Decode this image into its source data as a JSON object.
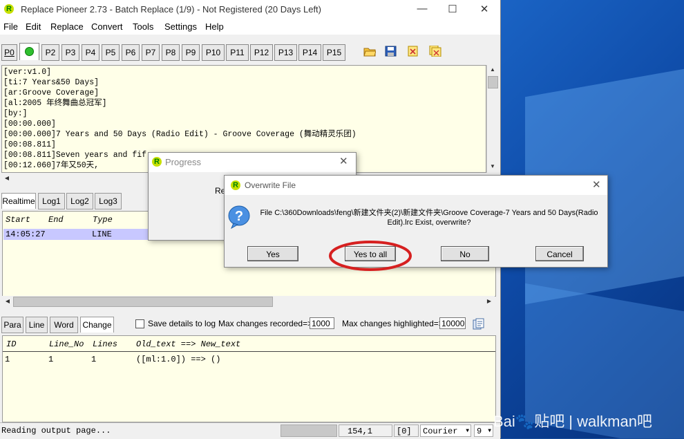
{
  "window": {
    "title": "Replace Pioneer 2.73 - Batch Replace (1/9) - Not Registered (20 Days Left)",
    "logo_letter": "R",
    "minimize": "—",
    "maximize": "☐",
    "close": "✕"
  },
  "menu": [
    "File",
    "Edit",
    "Replace",
    "Convert",
    "Tools",
    "Settings",
    "Help"
  ],
  "ptabs": [
    "P0",
    "",
    "P2",
    "P3",
    "P4",
    "P5",
    "P6",
    "P7",
    "P8",
    "P9",
    "P10",
    "P11",
    "P12",
    "P13",
    "P14",
    "P15"
  ],
  "editor_lines": [
    "[ver:v1.0]",
    "[ti:7 Years&50 Days]",
    "[ar:Groove Coverage]",
    "[al:2005 年终舞曲总冠军]",
    "[by:]",
    "[00:00.000]",
    "[00:00.000]7 Years and 50 Days (Radio Edit) - Groove Coverage (舞动精灵乐团)",
    "[00:08.811]",
    "[00:08.811]Seven years and fif",
    "[00:12.060]7年又50天,"
  ],
  "log_tabs": [
    "Realtime",
    "Log1",
    "Log2",
    "Log3"
  ],
  "log_headers": {
    "start": "Start",
    "end": "End",
    "type": "Type"
  },
  "log_row": {
    "start": "14:05:27",
    "type": "LINE"
  },
  "bottom_tabs": [
    "Para",
    "Line",
    "Word",
    "Change"
  ],
  "options": {
    "save_details": "Save details to log",
    "max_recorded_label": "Max changes recorded=>",
    "max_recorded": "1000",
    "max_highlighted_label": "Max changes highlighted=>",
    "max_highlighted": "10000"
  },
  "change_headers": {
    "id": "ID",
    "line_no": "Line_No",
    "lines": "Lines",
    "old_new": "Old_text ==> New_text"
  },
  "change_row": {
    "id": "1",
    "line_no": "1",
    "lines": "1",
    "text": "([ml:1.0]) ==> ()"
  },
  "status": {
    "message": "Reading output page...",
    "position": "154,1",
    "count": "[0]",
    "font": "Courier",
    "size": "9"
  },
  "progress_dialog": {
    "title": "Progress",
    "text": "Re"
  },
  "overwrite_dialog": {
    "title": "Overwrite File",
    "message_line1": "File C:\\360Downloads\\feng\\新建文件夹(2)\\新建文件夹\\Groove Coverage-7 Years and 50 Days(Radio",
    "message_line2": "Edit).lrc Exist, overwrite?",
    "buttons": {
      "yes": "Yes",
      "yes_all": "Yes to all",
      "no": "No",
      "cancel": "Cancel"
    },
    "highlight_color": "#d62020"
  },
  "watermark": "Bai🐾贴吧 | walkman吧"
}
